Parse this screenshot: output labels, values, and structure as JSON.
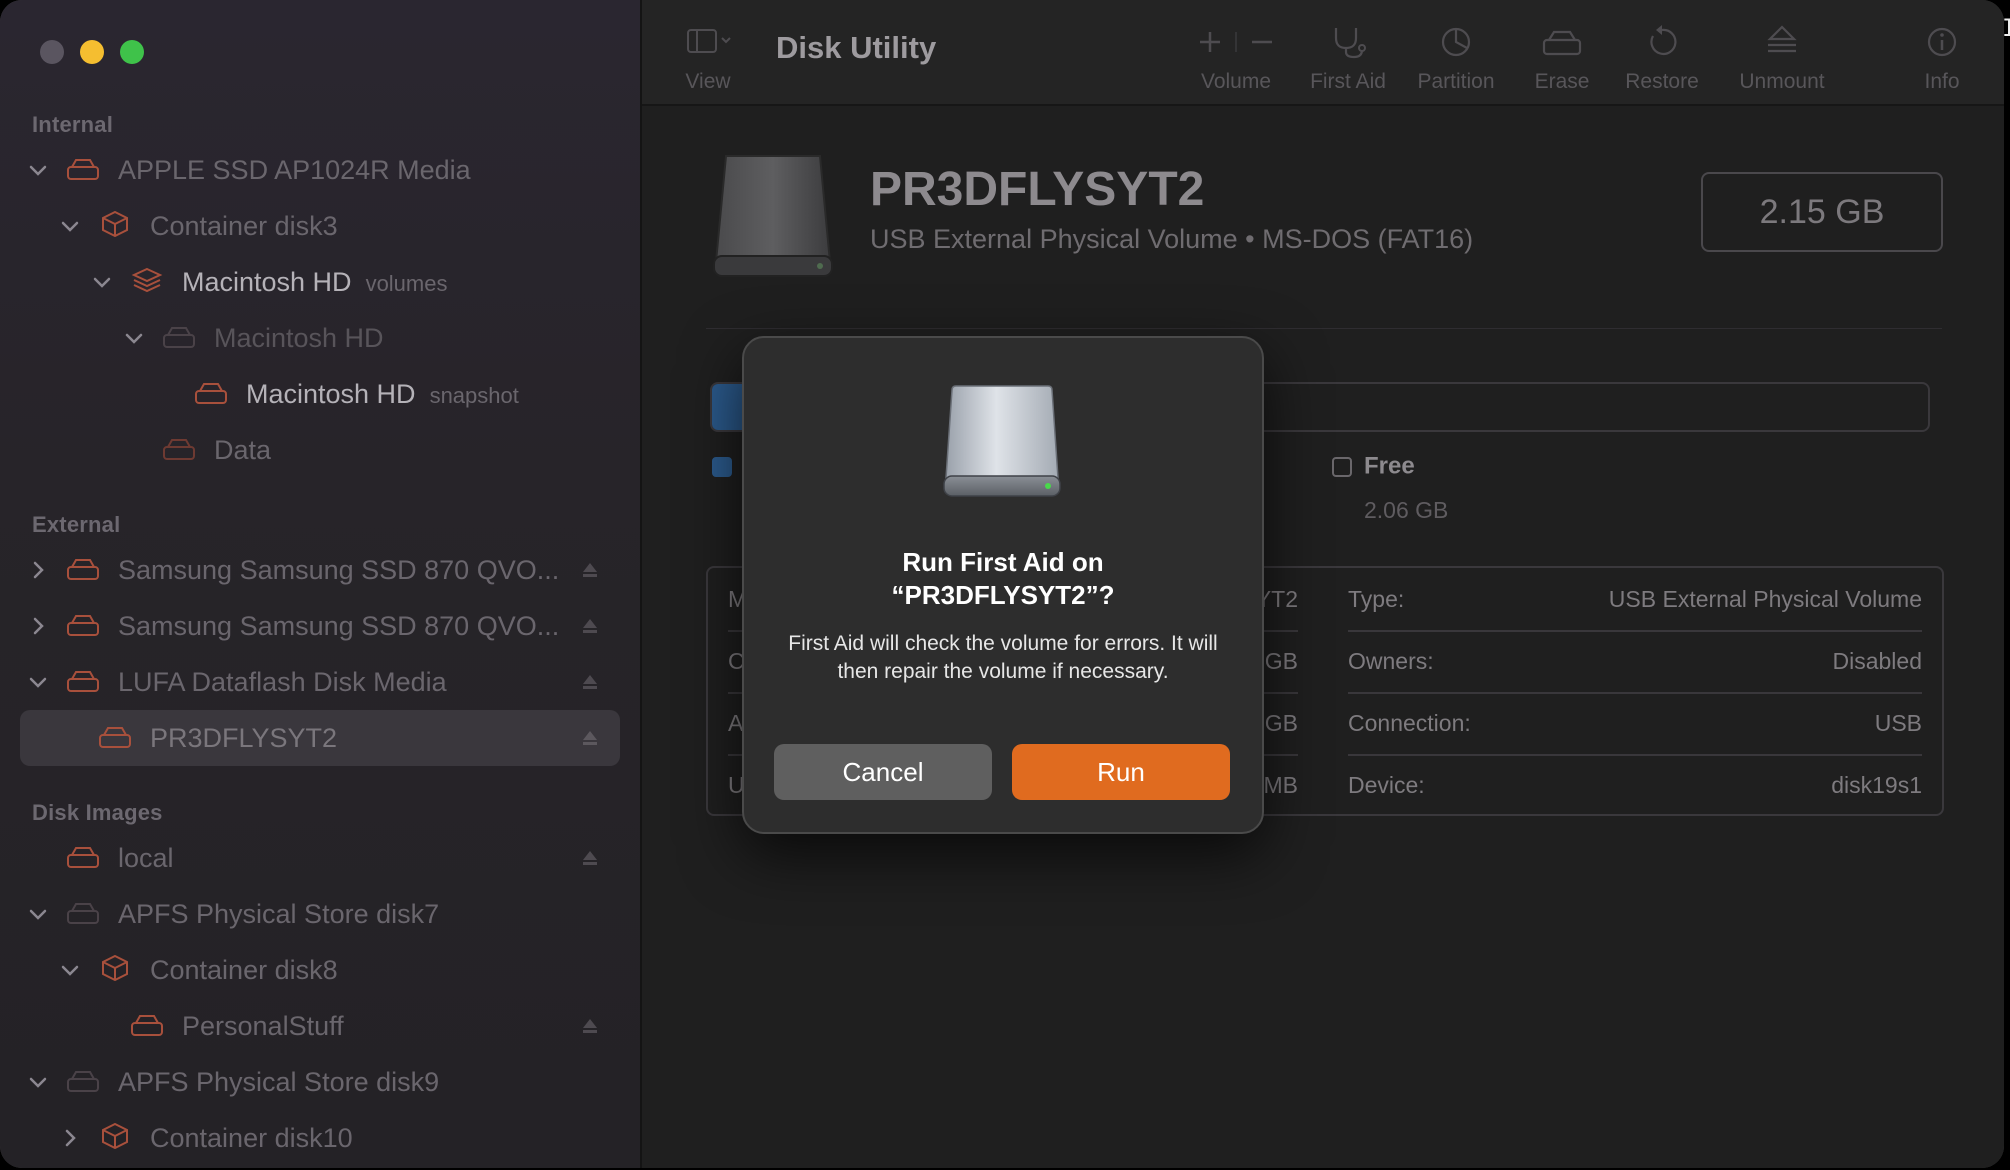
{
  "sidebar": {
    "sections": {
      "internal": "Internal",
      "external": "External",
      "disk_images": "Disk Images"
    },
    "items": [
      {
        "label": "APPLE SSD AP1024R Media",
        "sub": ""
      },
      {
        "label": "Container disk3",
        "sub": ""
      },
      {
        "label": "Macintosh HD",
        "sub": "volumes"
      },
      {
        "label": "Macintosh HD",
        "sub": ""
      },
      {
        "label": "Macintosh HD",
        "sub": "snapshot"
      },
      {
        "label": "Data",
        "sub": ""
      },
      {
        "label": "Samsung Samsung SSD 870 QVO...",
        "sub": ""
      },
      {
        "label": "Samsung Samsung SSD 870 QVO...",
        "sub": ""
      },
      {
        "label": "LUFA Dataflash Disk Media",
        "sub": ""
      },
      {
        "label": "PR3DFLYSYT2",
        "sub": ""
      },
      {
        "label": "local",
        "sub": ""
      },
      {
        "label": "APFS Physical Store disk7",
        "sub": ""
      },
      {
        "label": "Container disk8",
        "sub": ""
      },
      {
        "label": "PersonalStuff",
        "sub": ""
      },
      {
        "label": "APFS Physical Store disk9",
        "sub": ""
      },
      {
        "label": "Container disk10",
        "sub": ""
      }
    ]
  },
  "toolbar": {
    "title": "Disk Utility",
    "view": "View",
    "volume": "Volume",
    "first_aid": "First Aid",
    "partition": "Partition",
    "erase": "Erase",
    "restore": "Restore",
    "unmount": "Unmount",
    "info": "Info"
  },
  "volume": {
    "name": "PR3DFLYSYT2",
    "description": "USB External Physical Volume • MS-DOS (FAT16)",
    "capacity": "2.15 GB",
    "used_fraction": 0.04,
    "free_label": "Free",
    "free_value": "2.06 GB"
  },
  "info": {
    "left": [
      {
        "key": "M",
        "value": "YT2"
      },
      {
        "key": "C",
        "value": "GB"
      },
      {
        "key": "A",
        "value": "GB"
      },
      {
        "key": "U",
        "value": "MB"
      }
    ],
    "right": [
      {
        "key": "Type:",
        "value": "USB External Physical Volume"
      },
      {
        "key": "Owners:",
        "value": "Disabled"
      },
      {
        "key": "Connection:",
        "value": "USB"
      },
      {
        "key": "Device:",
        "value": "disk19s1"
      }
    ]
  },
  "dialog": {
    "title_line1": "Run First Aid on",
    "title_line2": "“PR3DFLYSYT2”?",
    "message": "First Aid will check the volume for errors. It will then repair the volume if necessary.",
    "cancel": "Cancel",
    "run": "Run"
  },
  "colors": {
    "accent_orange": "#e06b1f",
    "cancel_gray": "#5f5f5f",
    "used_blue": "#2b5a8c",
    "close": "#5a5560",
    "minimize": "#f5be30",
    "maximize": "#3fc24a"
  }
}
